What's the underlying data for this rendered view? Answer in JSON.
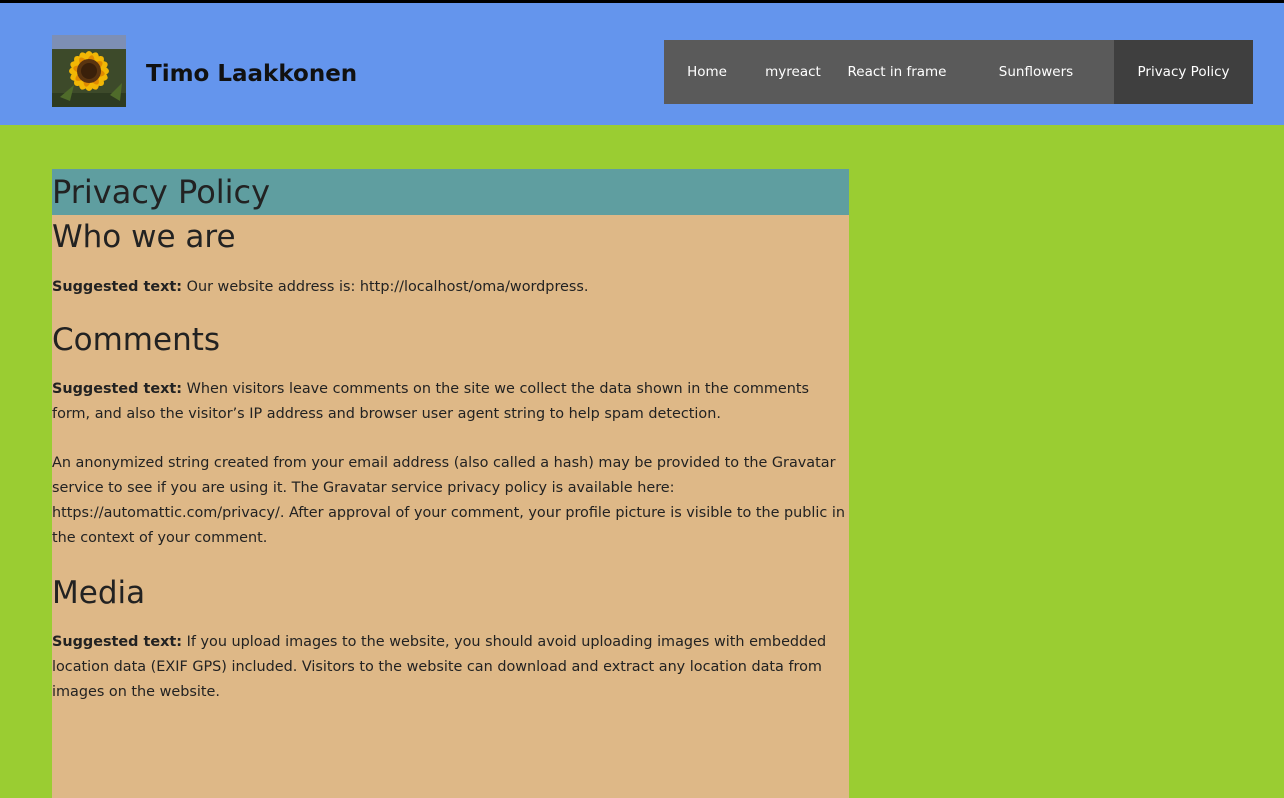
{
  "header": {
    "site_title": "Timo Laakkonen",
    "logo_icon": "sunflower-logo-icon",
    "nav": [
      {
        "label": "Home"
      },
      {
        "label": "myreact"
      },
      {
        "label": "React in frame"
      },
      {
        "label": "Sunflowers"
      },
      {
        "label": "Privacy Policy",
        "active": true
      }
    ]
  },
  "page": {
    "title": "Privacy Policy",
    "sections": {
      "who": {
        "heading": "Who we are",
        "p1_lead": "Suggested text:",
        "p1_text": " Our website address is: http://localhost/oma/wordpress."
      },
      "comments": {
        "heading": "Comments",
        "p1_lead": "Suggested text:",
        "p1_text": " When visitors leave comments on the site we collect the data shown in the comments form, and also the visitor’s IP address and browser user agent string to help spam detection.",
        "p2_text": "An anonymized string created from your email address (also called a hash) may be provided to the Gravatar service to see if you are using it. The Gravatar service privacy policy is available here: https://automattic.com/privacy/. After approval of your comment, your profile picture is visible to the public in the context of your comment."
      },
      "media": {
        "heading": "Media",
        "p1_lead": "Suggested text:",
        "p1_text": " If you upload images to the website, you should avoid uploading images with embedded location data (EXIF GPS) included. Visitors to the website can download and extract any location data from images on the website."
      }
    }
  },
  "colors": {
    "page_bg": "#9acd32",
    "header_bg": "#6495ed",
    "nav_bg": "#5a5a5a",
    "nav_active_bg": "#3f3f3f",
    "content_bg": "#deb887",
    "title_bar_bg": "#5f9ea0"
  }
}
